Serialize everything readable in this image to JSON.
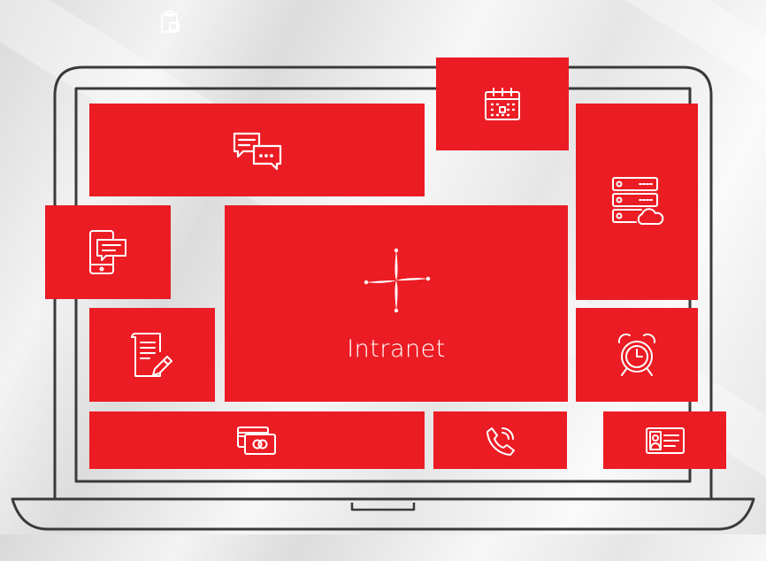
{
  "brand": {
    "accent_color": "#ec1c24",
    "icon_color": "#ffffff",
    "laptop_outline_color": "#3a3a3a"
  },
  "tiles": {
    "chat": {
      "icon": "chat-bubbles-icon"
    },
    "calendar": {
      "icon": "calendar-icon"
    },
    "servers": {
      "icon": "server-cloud-icon"
    },
    "mobile_message": {
      "icon": "mobile-message-icon"
    },
    "intranet": {
      "icon": "intranet-logo-icon",
      "label": "Intranet"
    },
    "document_edit": {
      "icon": "document-edit-icon"
    },
    "alarm": {
      "icon": "alarm-clock-icon"
    },
    "cards": {
      "icon": "payment-cards-icon"
    },
    "phone": {
      "icon": "phone-call-icon"
    },
    "id_card": {
      "icon": "id-card-icon"
    }
  },
  "background_icon": "clipboard-icon"
}
